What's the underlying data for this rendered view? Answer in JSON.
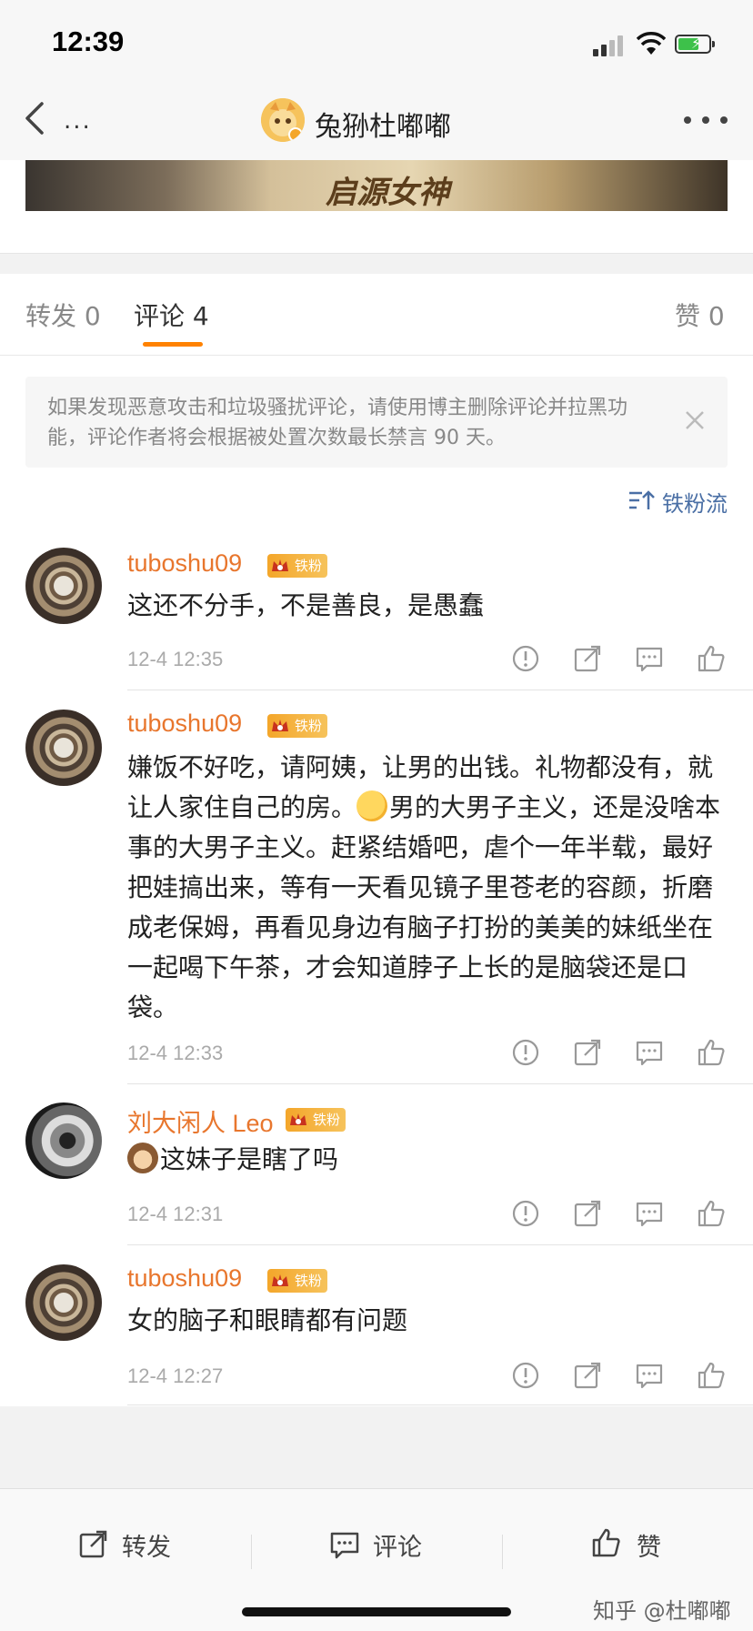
{
  "status_bar": {
    "time": "12:39"
  },
  "nav": {
    "ellipsis": "...",
    "title": "兔狲杜嘟嘟"
  },
  "banner": {
    "text": "启源女神"
  },
  "tabs": [
    {
      "label": "转发",
      "count": "0"
    },
    {
      "label": "评论",
      "count": "4"
    },
    {
      "label": "赞",
      "count": "0"
    }
  ],
  "notice": {
    "text": "如果发现恶意攻击和垃圾骚扰评论，请使用博主删除评论并拉黑功能，评论作者将会根据被处置次数最长禁言 90 天。"
  },
  "sort": {
    "label": "铁粉流"
  },
  "badge_label": "铁粉",
  "comments": [
    {
      "user": "tuboshu09",
      "text": "这还不分手，不是善良，是愚蠢",
      "time": "12-4 12:35"
    },
    {
      "user": "tuboshu09",
      "text_emoji": "sweat-emoji",
      "text_before": "嫌饭不好吃，请阿姨，让男的出钱。礼物都没有，就让人家住自己的房。",
      "text_after": "男的大男子主义，还是没啥本事的大男子主义。赶紧结婚吧，虐个一年半载，最好把娃搞出来，等有一天看见镜子里苍老的容颜，折磨成老保姆，再看见身边有脑子打扮的美美的妹纸坐在一起喝下午茶，才会知道脖子上长的是脑袋还是口袋。",
      "time": "12-4 12:33"
    },
    {
      "user": "刘大闲人 Leo",
      "text_emoji": "see-no-evil-monkey-emoji",
      "text": "这妹子是瞎了吗",
      "time": "12-4 12:31"
    },
    {
      "user": "tuboshu09",
      "text": "女的脑子和眼睛都有问题",
      "time": "12-4 12:27"
    }
  ],
  "bottom_bar": {
    "repost": "转发",
    "comment": "评论",
    "like": "赞"
  },
  "watermark": "知乎 @杜嘟嘟",
  "colors": {
    "accent": "#ff8200",
    "username": "#e8762d",
    "link": "#4a6fa5"
  }
}
